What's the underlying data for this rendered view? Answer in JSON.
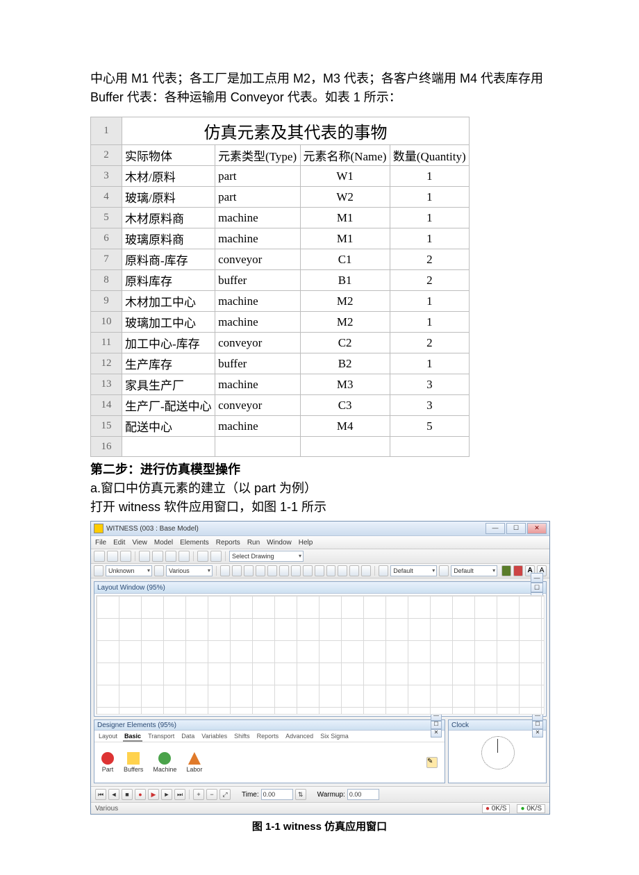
{
  "intro": "中心用 M1 代表；各工厂是加工点用  M2，M3 代表；各客户终端用 M4 代表库存用  Buffer 代表：各种运输用 Conveyor 代表。如表 1 所示：",
  "table": {
    "title": "仿真元素及其代表的事物",
    "headers": [
      "实际物体",
      "元素类型(Type)",
      "元素名称(Name)",
      "数量(Quantity)"
    ],
    "rows": [
      {
        "n": "3",
        "a": "木材/原料",
        "b": "part",
        "c": "W1",
        "d": "1"
      },
      {
        "n": "4",
        "a": "玻璃/原料",
        "b": "part",
        "c": "W2",
        "d": "1"
      },
      {
        "n": "5",
        "a": "木材原料商",
        "b": "machine",
        "c": "M1",
        "d": "1"
      },
      {
        "n": "6",
        "a": "玻璃原料商",
        "b": "machine",
        "c": "M1",
        "d": "1"
      },
      {
        "n": "7",
        "a": "原料商-库存",
        "b": "conveyor",
        "c": "C1",
        "d": "2"
      },
      {
        "n": "8",
        "a": "原料库存",
        "b": "buffer",
        "c": "B1",
        "d": "2"
      },
      {
        "n": "9",
        "a": "木材加工中心",
        "b": "machine",
        "c": "M2",
        "d": "1"
      },
      {
        "n": "10",
        "a": "玻璃加工中心",
        "b": "machine",
        "c": "M2",
        "d": "1"
      },
      {
        "n": "11",
        "a": "加工中心-库存",
        "b": "conveyor",
        "c": "C2",
        "d": "2"
      },
      {
        "n": "12",
        "a": "生产库存",
        "b": "buffer",
        "c": "B2",
        "d": "1"
      },
      {
        "n": "13",
        "a": "家具生产厂",
        "b": "machine",
        "c": "M3",
        "d": "3"
      },
      {
        "n": "14",
        "a": "生产厂-配送中心",
        "b": "conveyor",
        "c": "C3",
        "d": "3"
      },
      {
        "n": "15",
        "a": "配送中心",
        "b": "machine",
        "c": "M4",
        "d": "5"
      }
    ],
    "lastRowNum": "16"
  },
  "step2": {
    "heading": "第二步：进行仿真模型操作",
    "lineA": "a.窗口中仿真元素的建立（以 part 为例）",
    "lineB": "打开 witness 软件应用窗口，如图 1-1 所示"
  },
  "witness": {
    "title": "WITNESS (003 : Base Model)",
    "menus": [
      "File",
      "Edit",
      "View",
      "Model",
      "Elements",
      "Reports",
      "Run",
      "Window",
      "Help"
    ],
    "toolbar2": {
      "unknown": "Unknown",
      "various": "Various",
      "selectDrawing": "Select Drawing",
      "default1": "Default",
      "default2": "Default"
    },
    "layoutTitle": "Layout Window (95%)",
    "elements": {
      "title": "Designer Elements (95%)",
      "tabs": [
        "Layout",
        "Basic",
        "Transport",
        "Data",
        "Variables",
        "Shifts",
        "Reports",
        "Advanced",
        "Six Sigma"
      ],
      "activeTab": "Basic",
      "items": [
        {
          "name": "Part",
          "cls": "part"
        },
        {
          "name": "Buffers",
          "cls": "buffers"
        },
        {
          "name": "Machine",
          "cls": "machine"
        },
        {
          "name": "Labor",
          "cls": "labor"
        }
      ]
    },
    "clockTitle": "Clock",
    "run": {
      "timeLabel": "Time:",
      "timeVal": "0.00",
      "warmupLabel": "Warmup:",
      "warmupVal": "0.00"
    },
    "status": {
      "left": "Various",
      "r1": "0K/S",
      "r2": "0K/S"
    }
  },
  "figCaption": "图 1-1    witness 仿真应用窗口"
}
